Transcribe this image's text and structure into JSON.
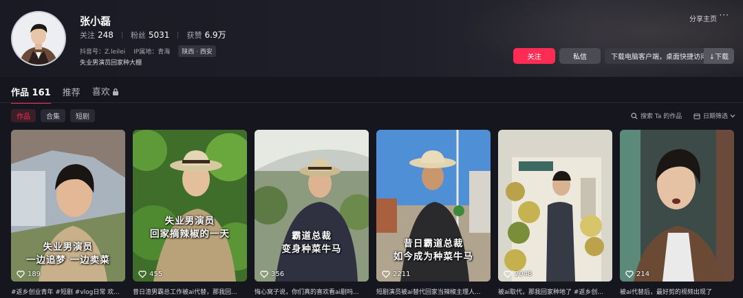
{
  "profile": {
    "name": "张小磊",
    "stats": [
      {
        "label": "关注",
        "value": "248"
      },
      {
        "label": "粉丝",
        "value": "5031"
      },
      {
        "label": "获赞",
        "value": "6.9万"
      }
    ],
    "douyin_id": "抖音号：Z.leilei",
    "ip_location": "IP属地：青海",
    "region_tag": "陕西 · 西安",
    "bio": "失业男演员回家种大棚"
  },
  "header_actions": {
    "share": "分享主页",
    "more": "···",
    "follow": "关注",
    "message": "私信",
    "download_hint": "下载电脑客户端，桌面快捷访问",
    "download": "↓下载"
  },
  "tabs": [
    {
      "label": "作品 161",
      "active": true
    },
    {
      "label": "推荐",
      "active": false
    },
    {
      "label": "喜欢",
      "active": false
    }
  ],
  "subtabs": [
    {
      "label": "作品",
      "active": true
    },
    {
      "label": "合集",
      "active": false
    },
    {
      "label": "短剧",
      "active": false
    }
  ],
  "search_placeholder": "搜索 Ta 的作品",
  "date_filter": "日期筛选",
  "videos": [
    {
      "likes": "189",
      "overlay": [
        "失业男演员",
        "一边追梦 一边卖菜"
      ],
      "caption": "#返乡创业青年 #短剧 #vlog日常 欢..."
    },
    {
      "likes": "455",
      "overlay": [
        "失业男演员",
        "回家摘辣椒的一天"
      ],
      "caption": "昔日渣男霸总工作被ai代替，那我回..."
    },
    {
      "likes": "356",
      "overlay": [
        "霸道总裁",
        "变身种菜牛马"
      ],
      "caption": "悔心窝子说，你们真的喜欢看ai剧吗..."
    },
    {
      "likes": "2211",
      "overlay": [
        "昔日霸道总裁",
        "如今成为种菜牛马"
      ],
      "caption": "短剧演员被ai替代回家当辣椒主理人..."
    },
    {
      "likes": "2048",
      "overlay": [],
      "caption": "被ai取代，那我回家种地了 #返乡创..."
    },
    {
      "likes": "214",
      "overlay": [],
      "caption": "被ai代替后，最好剪的视频出现了"
    }
  ],
  "colors": {
    "accent": "#fe2c55",
    "background": "#16161f"
  }
}
